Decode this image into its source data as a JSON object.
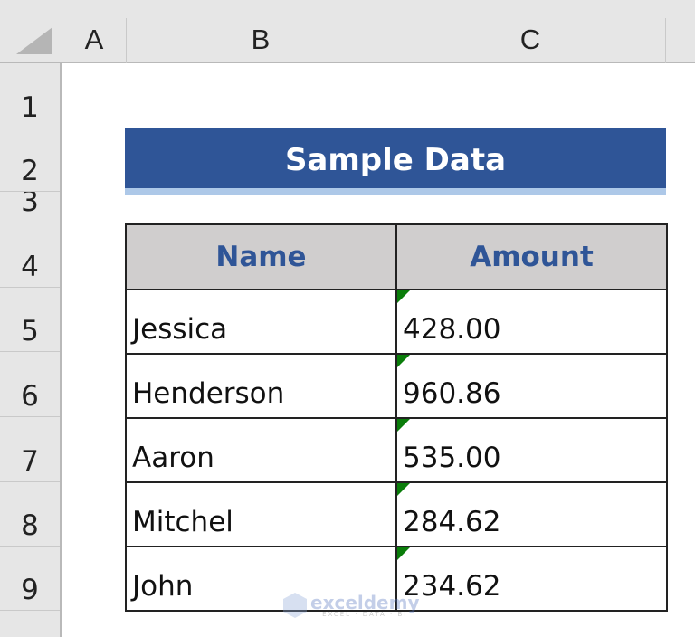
{
  "sheet": {
    "column_headers": [
      "A",
      "B",
      "C"
    ],
    "row_headers": [
      "1",
      "2",
      "3",
      "4",
      "5",
      "6",
      "7",
      "8",
      "9"
    ]
  },
  "title": "Sample Data",
  "table": {
    "headers": [
      "Name",
      "Amount"
    ],
    "rows": [
      {
        "name": "Jessica",
        "amount": "428.00"
      },
      {
        "name": "Henderson",
        "amount": "960.86"
      },
      {
        "name": "Aaron",
        "amount": "535.00"
      },
      {
        "name": "Mitchel",
        "amount": "284.62"
      },
      {
        "name": "John",
        "amount": "234.62"
      }
    ],
    "amount_error_indicator": "number-stored-as-text"
  },
  "watermark": {
    "brand": "exceldemy",
    "tagline": "EXCEL · DATA · BI"
  },
  "colors": {
    "title_fill": "#2f5597",
    "title_underline": "#adc8e8",
    "header_fill": "#d0cece",
    "header_text": "#2f5597",
    "error_indicator": "#0a7d0a"
  }
}
